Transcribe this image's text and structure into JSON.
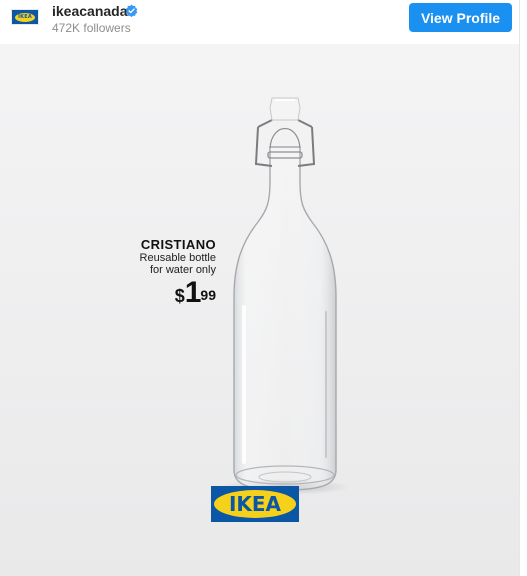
{
  "profile": {
    "avatar_text": "IKEA",
    "name": "ikeacanada",
    "followers": "472K followers",
    "view_button": "View Profile"
  },
  "post": {
    "product_name": "CRISTIANO",
    "product_desc_line1": "Reusable bottle",
    "product_desc_line2": "for water only",
    "price_currency": "$",
    "price_main": "1",
    "price_cents": "99",
    "logo_text": "IKEA"
  },
  "colors": {
    "button": "#1a90f0",
    "verified": "#3897f0",
    "ikea_blue": "#0b56a5",
    "ikea_yellow": "#f6d11b"
  },
  "icons": [
    "verified-badge-icon",
    "ikea-avatar",
    "glass-bottle-image",
    "ikea-logo"
  ]
}
